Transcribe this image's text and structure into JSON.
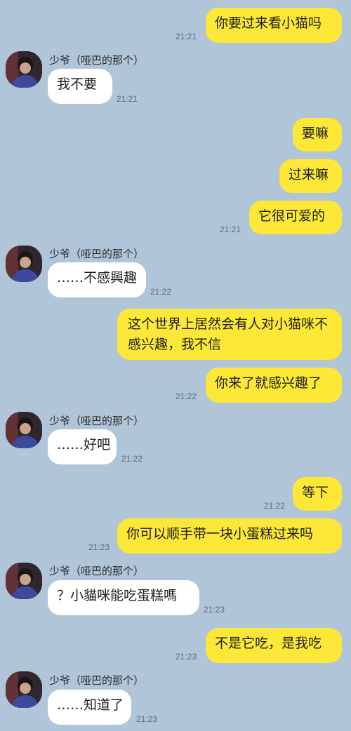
{
  "contact": {
    "name": "少爷（哑巴的那个）"
  },
  "messages": [
    {
      "from": "me",
      "text": "你要过来看小猫吗",
      "time": "21:21"
    },
    {
      "from": "other",
      "text": "我不要",
      "time": "21:21"
    },
    {
      "from": "me",
      "text": "要嘛",
      "time": ""
    },
    {
      "from": "me",
      "text": "过来嘛",
      "time": ""
    },
    {
      "from": "me",
      "text": "它很可爱的",
      "time": "21:21"
    },
    {
      "from": "other",
      "text": "……不感興趣",
      "time": "21:22"
    },
    {
      "from": "me",
      "text": "这个世界上居然会有人对小猫咪不感兴趣，我不信",
      "time": ""
    },
    {
      "from": "me",
      "text": "你来了就感兴趣了",
      "time": "21:22"
    },
    {
      "from": "other",
      "text": "……好吧",
      "time": "21:22"
    },
    {
      "from": "me",
      "text": "等下",
      "time": "21:22"
    },
    {
      "from": "me",
      "text": "你可以顺手带一块小蛋糕过来吗",
      "time": "21:23"
    },
    {
      "from": "other",
      "text": "？小貓咪能吃蛋糕嗎",
      "time": "21:23"
    },
    {
      "from": "me",
      "text": "不是它吃，是我吃",
      "time": "21:23"
    },
    {
      "from": "other",
      "text": "……知道了",
      "time": "21:23"
    }
  ]
}
